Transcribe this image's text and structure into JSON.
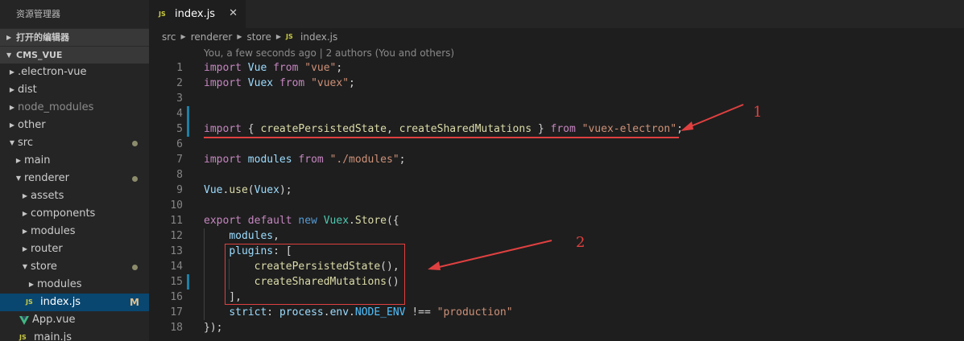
{
  "sidebar": {
    "title": "资源管理器",
    "sections": {
      "open_editors": "打开的编辑器",
      "project": "CMS_VUE"
    },
    "tree": [
      {
        "label": ".electron-vue",
        "type": "folder",
        "depth": 1,
        "expanded": false
      },
      {
        "label": "dist",
        "type": "folder",
        "depth": 1,
        "expanded": false
      },
      {
        "label": "node_modules",
        "type": "folder",
        "depth": 1,
        "expanded": false,
        "dim": true
      },
      {
        "label": "other",
        "type": "folder",
        "depth": 1,
        "expanded": false
      },
      {
        "label": "src",
        "type": "folder",
        "depth": 1,
        "expanded": true,
        "modified_dot": true
      },
      {
        "label": "main",
        "type": "folder",
        "depth": 2,
        "expanded": false
      },
      {
        "label": "renderer",
        "type": "folder",
        "depth": 2,
        "expanded": true,
        "modified_dot": true
      },
      {
        "label": "assets",
        "type": "folder",
        "depth": 3,
        "expanded": false
      },
      {
        "label": "components",
        "type": "folder",
        "depth": 3,
        "expanded": false
      },
      {
        "label": "modules",
        "type": "folder",
        "depth": 3,
        "expanded": false
      },
      {
        "label": "router",
        "type": "folder",
        "depth": 3,
        "expanded": false
      },
      {
        "label": "store",
        "type": "folder",
        "depth": 3,
        "expanded": true,
        "modified_dot": true
      },
      {
        "label": "modules",
        "type": "folder",
        "depth": 4,
        "expanded": false
      },
      {
        "label": "index.js",
        "type": "js",
        "depth": 4,
        "selected": true,
        "status": "M"
      },
      {
        "label": "App.vue",
        "type": "vue",
        "depth": 3
      },
      {
        "label": "main.js",
        "type": "js",
        "depth": 3
      }
    ]
  },
  "editor": {
    "tab": {
      "label": "index.js",
      "badge": "JS",
      "close": "✕"
    },
    "breadcrumb": [
      "src",
      "renderer",
      "store",
      "index.js"
    ],
    "blame": "You, a few seconds ago | 2 authors (You and others)",
    "line_numbers": [
      "1",
      "2",
      "3",
      "4",
      "5",
      "6",
      "7",
      "8",
      "9",
      "10",
      "11",
      "12",
      "13",
      "14",
      "15",
      "16",
      "17",
      "18"
    ]
  },
  "annotations": {
    "label_1": "1",
    "label_2": "2",
    "color": "#e04040"
  },
  "colors": {
    "keyword": "#569cd6",
    "import_keyword": "#c586c0",
    "string": "#ce9178",
    "function": "#dcdcaa",
    "variable": "#9cdcfe",
    "class": "#4ec9b0",
    "selection": "#094771"
  }
}
